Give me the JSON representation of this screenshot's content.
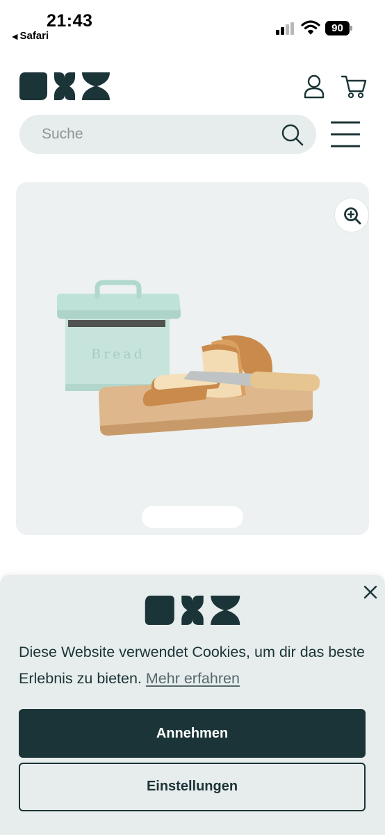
{
  "status_bar": {
    "time": "21:43",
    "back_app": "Safari",
    "battery": "90"
  },
  "header": {
    "logo_icon": "brand-logo-icon",
    "account_icon": "user-icon",
    "cart_icon": "cart-icon",
    "menu_icon": "hamburger-menu-icon"
  },
  "search": {
    "placeholder": "Suche",
    "value": "",
    "icon": "search-icon"
  },
  "product": {
    "zoom_icon": "zoom-in-icon",
    "image_lettering": "Bread"
  },
  "cookie": {
    "text": "Diese Website verwendet Cookies, um dir das beste Erlebnis zu bieten.",
    "link_label": "Mehr erfahren",
    "accept_label": "Annehmen",
    "settings_label": "Einstellungen",
    "close_icon": "close-icon"
  },
  "colors": {
    "brand_dark": "#1b3437",
    "surface": "#e7ecec",
    "image_bg": "#edf1f1"
  }
}
